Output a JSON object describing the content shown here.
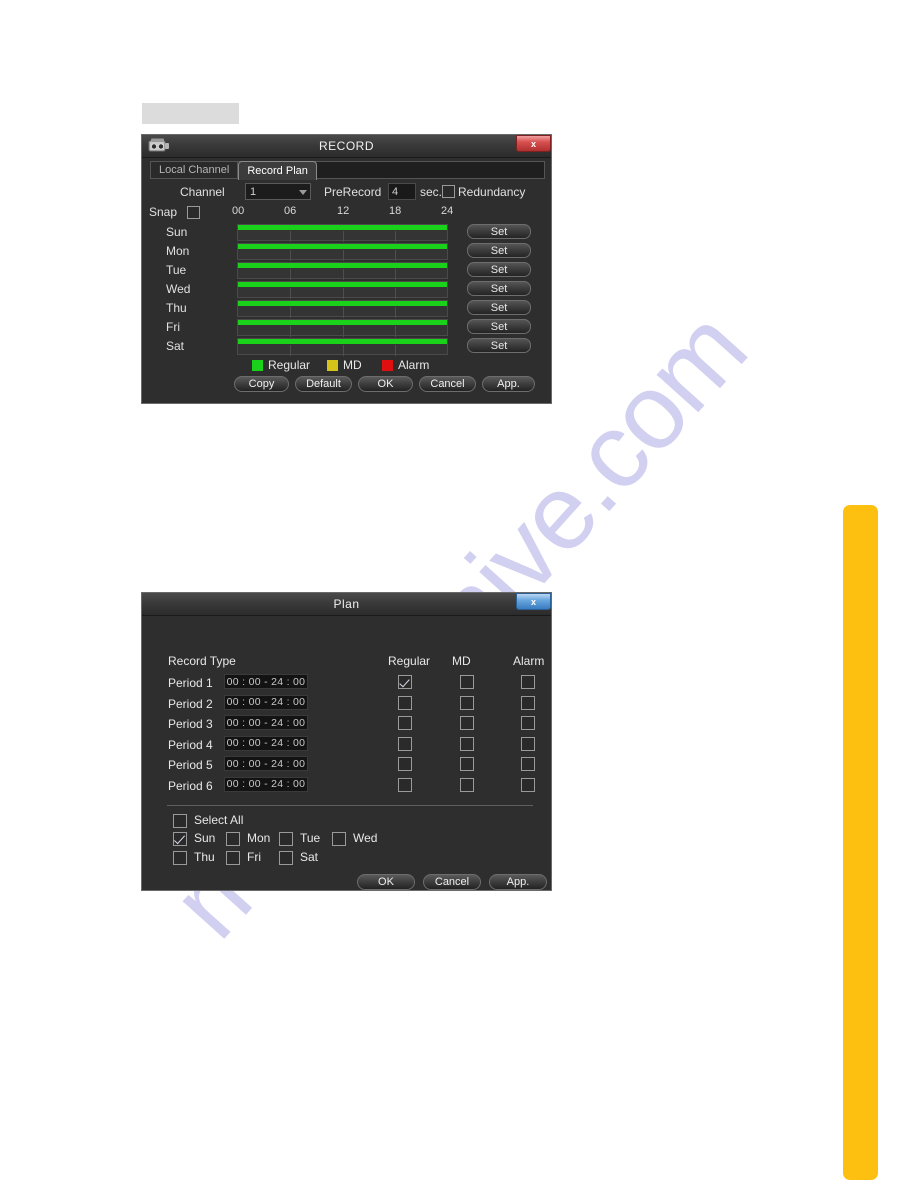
{
  "watermark": {
    "text": "manualshive.com"
  },
  "record_dialog": {
    "title": "RECORD",
    "close_label": "x",
    "icon": "camera-icon",
    "tabs": [
      {
        "label": "Local Channel",
        "active": false
      },
      {
        "label": "Record Plan",
        "active": true
      }
    ],
    "channel": {
      "label": "Channel",
      "value": "1"
    },
    "prerecord": {
      "label": "PreRecord",
      "value": "4",
      "unit": "sec."
    },
    "redundancy": {
      "label": "Redundancy",
      "checked": false
    },
    "snap": {
      "label": "Snap",
      "checked": false
    },
    "time_ticks": [
      "00",
      "06",
      "12",
      "18",
      "24"
    ],
    "days": [
      {
        "name": "Sun",
        "set_label": "Set",
        "fill_percent": 100,
        "type": "Regular"
      },
      {
        "name": "Mon",
        "set_label": "Set",
        "fill_percent": 100,
        "type": "Regular"
      },
      {
        "name": "Tue",
        "set_label": "Set",
        "fill_percent": 100,
        "type": "Regular"
      },
      {
        "name": "Wed",
        "set_label": "Set",
        "fill_percent": 100,
        "type": "Regular"
      },
      {
        "name": "Thu",
        "set_label": "Set",
        "fill_percent": 100,
        "type": "Regular"
      },
      {
        "name": "Fri",
        "set_label": "Set",
        "fill_percent": 100,
        "type": "Regular"
      },
      {
        "name": "Sat",
        "set_label": "Set",
        "fill_percent": 100,
        "type": "Regular"
      }
    ],
    "legend": [
      {
        "label": "Regular",
        "color": "#19d219"
      },
      {
        "label": "MD",
        "color": "#d4c41a"
      },
      {
        "label": "Alarm",
        "color": "#e01010"
      }
    ],
    "buttons": [
      {
        "label": "Copy"
      },
      {
        "label": "Default"
      },
      {
        "label": "OK"
      },
      {
        "label": "Cancel"
      },
      {
        "label": "App."
      }
    ]
  },
  "plan_dialog": {
    "title": "Plan",
    "close_label": "x",
    "record_type_label": "Record Type",
    "columns": [
      "Regular",
      "MD",
      "Alarm"
    ],
    "periods": [
      {
        "label": "Period 1",
        "time": "00 : 00 - 24 : 00",
        "regular": true,
        "md": false,
        "alarm": false
      },
      {
        "label": "Period 2",
        "time": "00 : 00 - 24 : 00",
        "regular": false,
        "md": false,
        "alarm": false
      },
      {
        "label": "Period 3",
        "time": "00 : 00 - 24 : 00",
        "regular": false,
        "md": false,
        "alarm": false
      },
      {
        "label": "Period 4",
        "time": "00 : 00 - 24 : 00",
        "regular": false,
        "md": false,
        "alarm": false
      },
      {
        "label": "Period 5",
        "time": "00 : 00 - 24 : 00",
        "regular": false,
        "md": false,
        "alarm": false
      },
      {
        "label": "Period 6",
        "time": "00 : 00 - 24 : 00",
        "regular": false,
        "md": false,
        "alarm": false
      }
    ],
    "select_all": {
      "label": "Select All",
      "checked": false
    },
    "days": [
      {
        "label": "Sun",
        "checked": true
      },
      {
        "label": "Mon",
        "checked": false
      },
      {
        "label": "Tue",
        "checked": false
      },
      {
        "label": "Wed",
        "checked": false
      },
      {
        "label": "Thu",
        "checked": false
      },
      {
        "label": "Fri",
        "checked": false
      },
      {
        "label": "Sat",
        "checked": false
      }
    ],
    "buttons": [
      {
        "label": "OK"
      },
      {
        "label": "Cancel"
      },
      {
        "label": "App."
      }
    ]
  }
}
